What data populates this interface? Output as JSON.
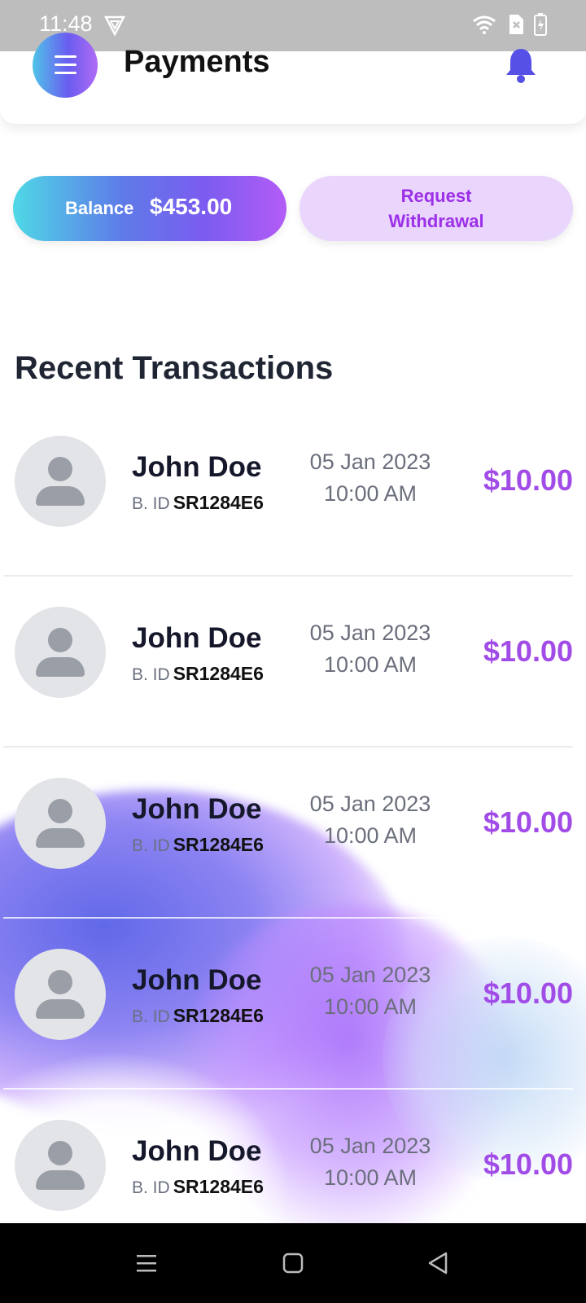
{
  "status_bar": {
    "time": "11:48"
  },
  "header": {
    "title": "Payments"
  },
  "balance": {
    "label": "Balance",
    "amount": "$453.00"
  },
  "withdraw": {
    "line1": "Request",
    "line2": "Withdrawal"
  },
  "section": {
    "title": "Recent Transactions"
  },
  "transactions": [
    {
      "name": "John Doe",
      "bid_label": "B. ID",
      "bid": "SR1284E6",
      "date": "05 Jan 2023",
      "time": "10:00 AM",
      "amount": "$10.00"
    },
    {
      "name": "John Doe",
      "bid_label": "B. ID",
      "bid": "SR1284E6",
      "date": "05 Jan 2023",
      "time": "10:00 AM",
      "amount": "$10.00"
    },
    {
      "name": "John Doe",
      "bid_label": "B. ID",
      "bid": "SR1284E6",
      "date": "05 Jan 2023",
      "time": "10:00 AM",
      "amount": "$10.00"
    },
    {
      "name": "John Doe",
      "bid_label": "B. ID",
      "bid": "SR1284E6",
      "date": "05 Jan 2023",
      "time": "10:00 AM",
      "amount": "$10.00"
    },
    {
      "name": "John Doe",
      "bid_label": "B. ID",
      "bid": "SR1284E6",
      "date": "05 Jan 2023",
      "time": "10:00 AM",
      "amount": "$10.00"
    }
  ],
  "colors": {
    "accent": "#a24ce8",
    "withdraw_bg": "#ead5fc",
    "status_bar": "#bdbdbd"
  }
}
